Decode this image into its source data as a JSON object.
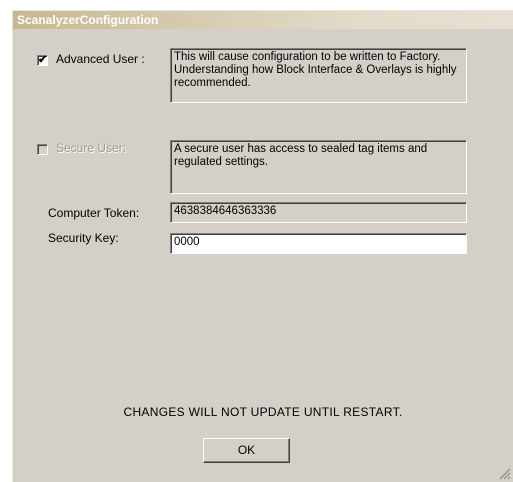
{
  "window": {
    "title": "ScanalyzerConfiguration"
  },
  "advanced_user": {
    "label": "Advanced User :",
    "checked": true,
    "check_glyph": "✔",
    "description": "This will cause configuration to be written to Factory. Understanding how Block Interface & Overlays is highly recommended."
  },
  "secure_user": {
    "label": "Secure User:",
    "checked": false,
    "enabled": false,
    "description": "A secure user has access to sealed tag items and regulated settings."
  },
  "computer_token": {
    "label": "Computer Token:",
    "value": "4638384646363336"
  },
  "security_key": {
    "label": "Security Key:",
    "value": "0000"
  },
  "note": "CHANGES WILL NOT UPDATE UNTIL RESTART.",
  "ok_button": {
    "label": "OK"
  },
  "icons": {
    "grip": "resize-grip-icon"
  }
}
